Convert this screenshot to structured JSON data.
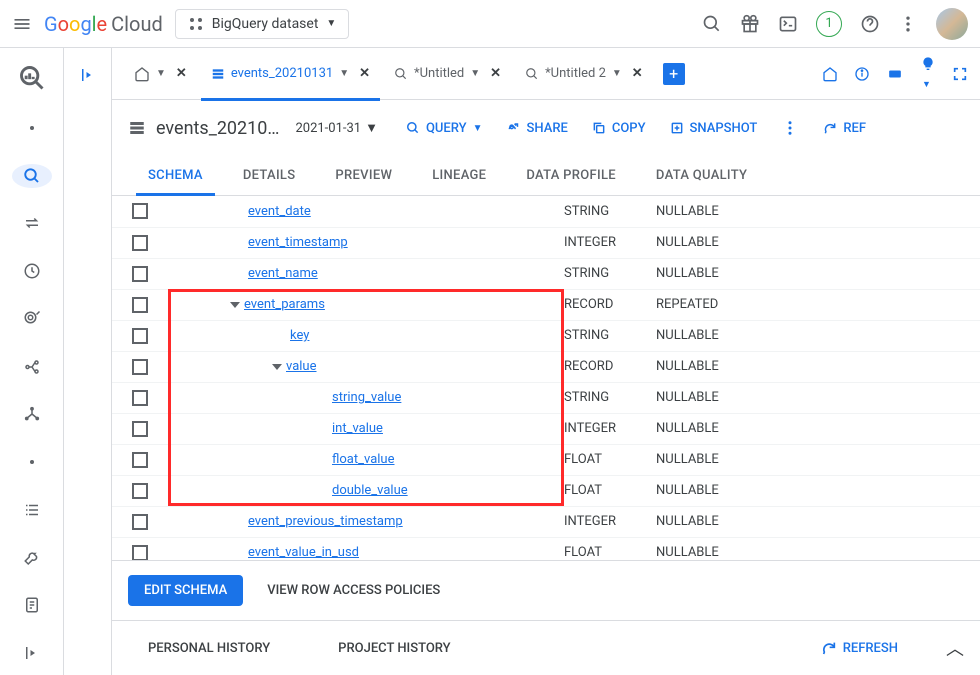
{
  "topbar": {
    "logo_cloud": "Cloud",
    "project": "BigQuery dataset",
    "badge": "1"
  },
  "tabs": [
    {
      "label": "",
      "home": true
    },
    {
      "label": "events_20210131",
      "active": true,
      "icon": "table"
    },
    {
      "label": "*Untitled",
      "icon": "query"
    },
    {
      "label": "*Untitled 2",
      "icon": "query"
    }
  ],
  "title": {
    "name": "events_20210…",
    "date": "2021-01-31"
  },
  "actions": {
    "query": "QUERY",
    "share": "SHARE",
    "copy": "COPY",
    "snapshot": "SNAPSHOT",
    "refresh_right": "REF"
  },
  "subtabs": [
    "SCHEMA",
    "DETAILS",
    "PREVIEW",
    "LINEAGE",
    "DATA PROFILE",
    "DATA QUALITY"
  ],
  "schema": [
    {
      "name": "event_date",
      "type": "STRING",
      "mode": "NULLABLE",
      "indent": 0,
      "hl": false
    },
    {
      "name": "event_timestamp",
      "type": "INTEGER",
      "mode": "NULLABLE",
      "indent": 0,
      "hl": false
    },
    {
      "name": "event_name",
      "type": "STRING",
      "mode": "NULLABLE",
      "indent": 0,
      "hl": false
    },
    {
      "name": "event_params",
      "type": "RECORD",
      "mode": "REPEATED",
      "indent": 0,
      "caret": true,
      "hl": true
    },
    {
      "name": "key",
      "type": "STRING",
      "mode": "NULLABLE",
      "indent": 1,
      "hl": true
    },
    {
      "name": "value",
      "type": "RECORD",
      "mode": "NULLABLE",
      "indent": 1,
      "caret": true,
      "hl": true
    },
    {
      "name": "string_value",
      "type": "STRING",
      "mode": "NULLABLE",
      "indent": 2,
      "hl": true
    },
    {
      "name": "int_value",
      "type": "INTEGER",
      "mode": "NULLABLE",
      "indent": 2,
      "hl": true
    },
    {
      "name": "float_value",
      "type": "FLOAT",
      "mode": "NULLABLE",
      "indent": 2,
      "hl": true
    },
    {
      "name": "double_value",
      "type": "FLOAT",
      "mode": "NULLABLE",
      "indent": 2,
      "hl": true
    },
    {
      "name": "event_previous_timestamp",
      "type": "INTEGER",
      "mode": "NULLABLE",
      "indent": 0,
      "hl": false
    },
    {
      "name": "event_value_in_usd",
      "type": "FLOAT",
      "mode": "NULLABLE",
      "indent": 0,
      "hl": false
    }
  ],
  "footer": {
    "edit": "EDIT SCHEMA",
    "policies": "VIEW ROW ACCESS POLICIES",
    "personal": "PERSONAL HISTORY",
    "project_hist": "PROJECT HISTORY",
    "refresh": "REFRESH"
  }
}
